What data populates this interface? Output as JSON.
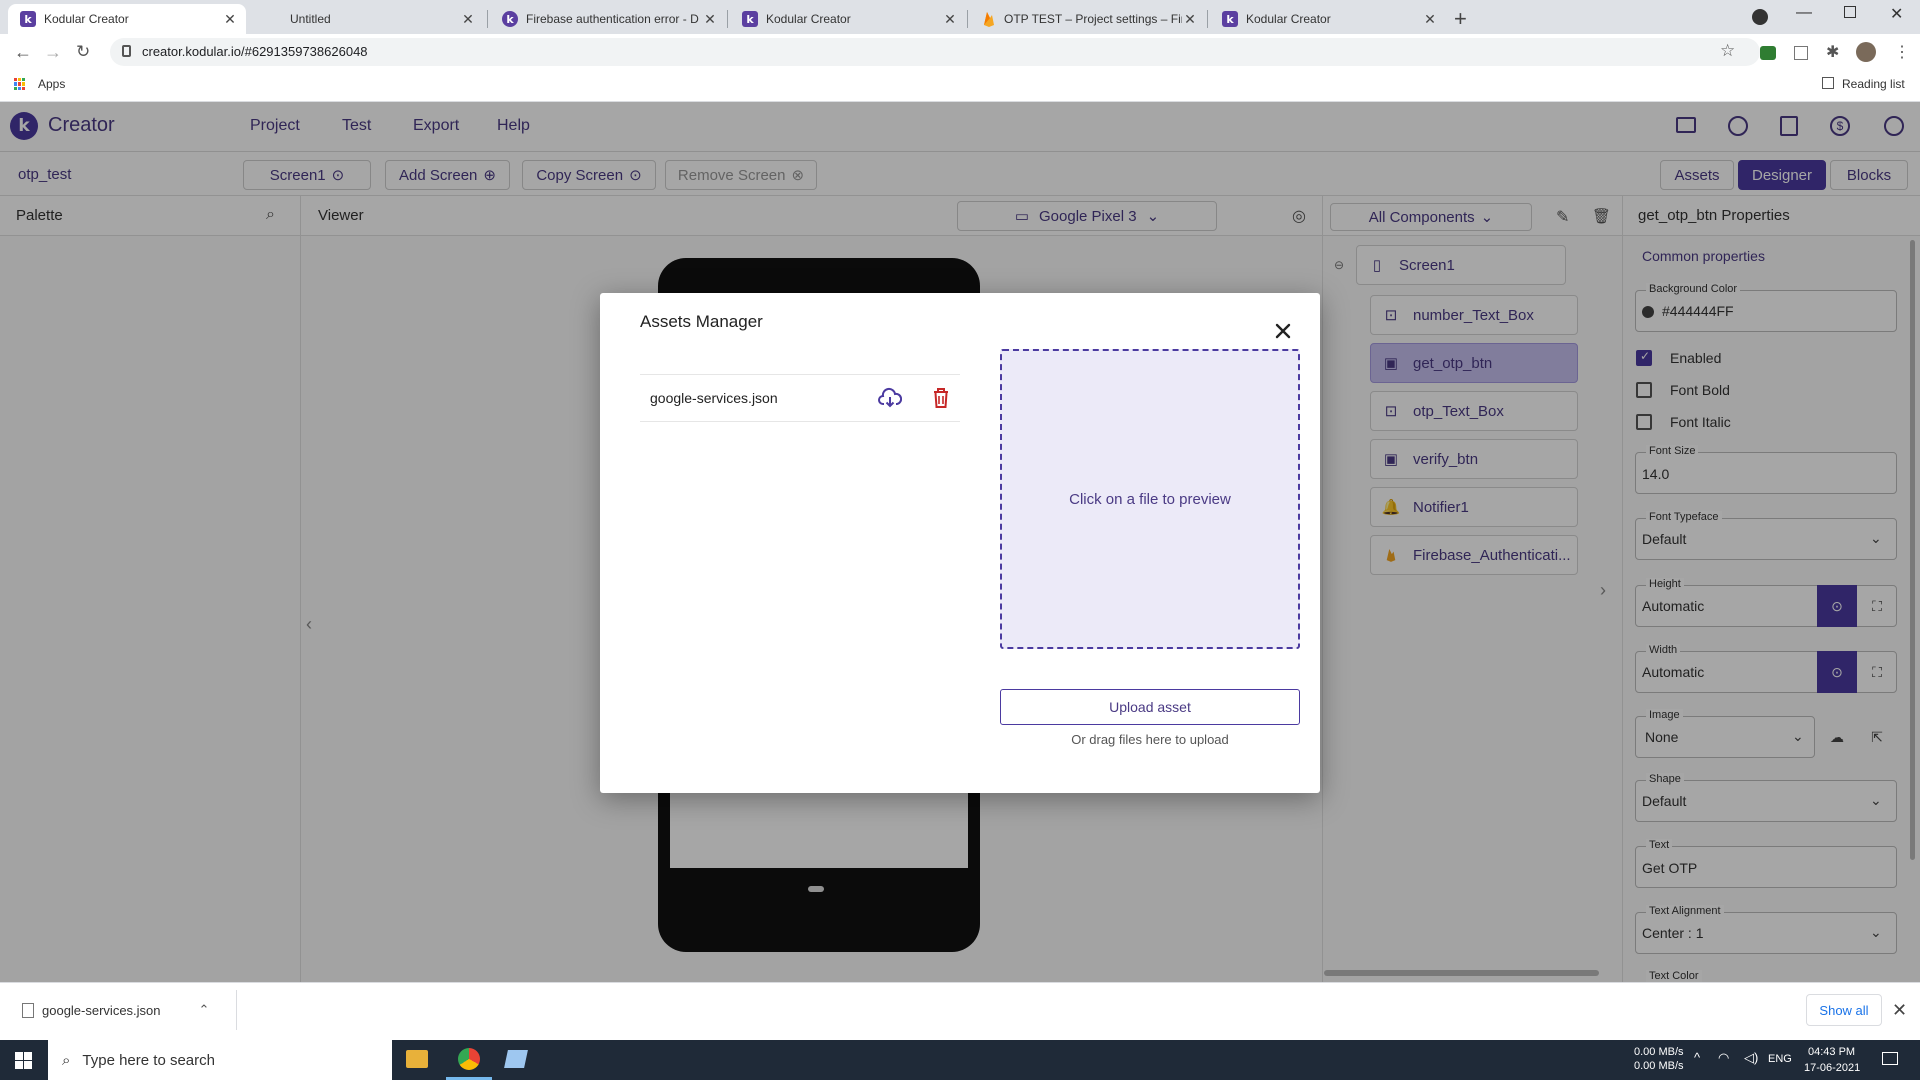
{
  "browser": {
    "tabs": [
      {
        "title": "Kodular Creator",
        "active": true
      },
      {
        "title": "Untitled",
        "active": false
      },
      {
        "title": "Firebase authentication error - D",
        "active": false
      },
      {
        "title": "Kodular Creator",
        "active": false
      },
      {
        "title": "OTP TEST – Project settings – Fire",
        "active": false
      },
      {
        "title": "Kodular Creator",
        "active": false
      }
    ],
    "url": "creator.kodular.io/#6291359738626048",
    "bookmarks_apps": "Apps",
    "reading_list": "Reading list"
  },
  "app": {
    "logo_text": "Creator",
    "menu": [
      "Project",
      "Test",
      "Export",
      "Help"
    ],
    "project_name": "otp_test",
    "toolbar": {
      "screen": "Screen1",
      "add_screen": "Add Screen",
      "copy_screen": "Copy Screen",
      "remove_screen": "Remove Screen"
    },
    "modes": [
      "Assets",
      "Designer",
      "Blocks"
    ],
    "active_mode": "Designer",
    "palette_title": "Palette",
    "viewer_title": "Viewer",
    "device": "Google Pixel 3",
    "components_dropdown": "All Components",
    "components": [
      {
        "name": "Screen1",
        "icon": "phone-icon"
      },
      {
        "name": "number_Text_Box",
        "icon": "textbox-icon"
      },
      {
        "name": "get_otp_btn",
        "icon": "button-icon",
        "selected": true
      },
      {
        "name": "otp_Text_Box",
        "icon": "textbox-icon"
      },
      {
        "name": "verify_btn",
        "icon": "button-icon"
      },
      {
        "name": "Notifier1",
        "icon": "bell-icon"
      },
      {
        "name": "Firebase_Authenticati...",
        "icon": "firebase-icon"
      }
    ],
    "properties": {
      "title": "get_otp_btn Properties",
      "section": "Common properties",
      "background_color_label": "Background Color",
      "background_color_value": "#444444FF",
      "enabled": "Enabled",
      "font_bold": "Font Bold",
      "font_italic": "Font Italic",
      "font_size_label": "Font Size",
      "font_size_value": "14.0",
      "font_typeface_label": "Font Typeface",
      "font_typeface_value": "Default",
      "height_label": "Height",
      "height_value": "Automatic",
      "width_label": "Width",
      "width_value": "Automatic",
      "image_label": "Image",
      "image_value": "None",
      "shape_label": "Shape",
      "shape_value": "Default",
      "text_label": "Text",
      "text_value": "Get OTP",
      "text_alignment_label": "Text Alignment",
      "text_alignment_value": "Center : 1",
      "text_color_label": "Text Color"
    }
  },
  "modal": {
    "title": "Assets Manager",
    "asset": "google-services.json",
    "preview_text": "Click on a file to preview",
    "upload_label": "Upload asset",
    "drag_hint": "Or drag files here to upload"
  },
  "downloads": {
    "file": "google-services.json",
    "show_all": "Show all"
  },
  "taskbar": {
    "search_placeholder": "Type here to search",
    "net_up": "0.00 MB/s",
    "net_down": "0.00 MB/s",
    "lang": "ENG",
    "time": "04:43 PM",
    "date": "17-06-2021"
  },
  "colors": {
    "brand": "#4b3aa0",
    "selected_item": "#c7c1f0",
    "preview_bg": "#eceaf8"
  }
}
